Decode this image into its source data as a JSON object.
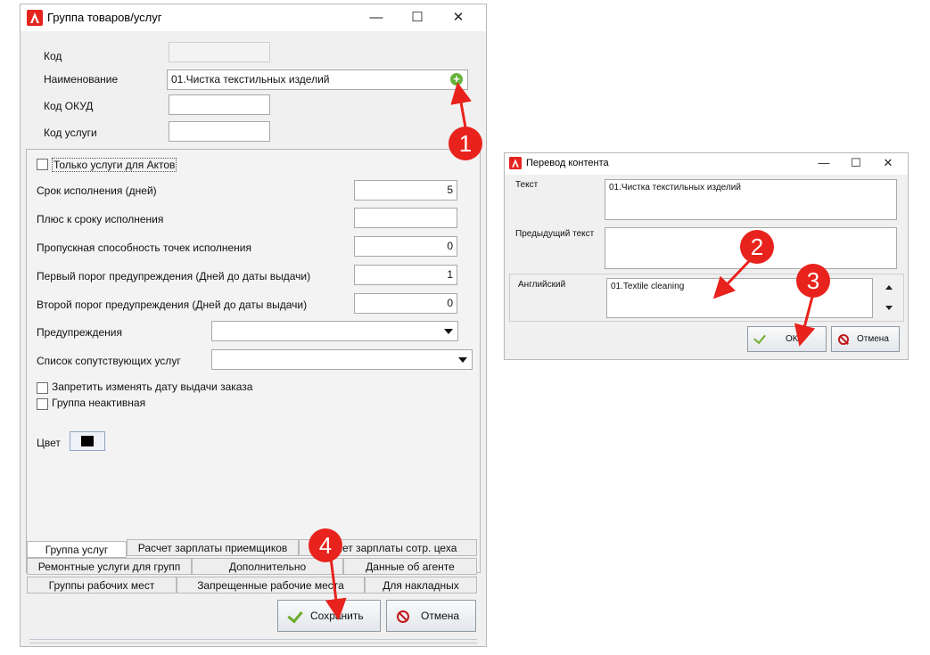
{
  "main_window": {
    "title": "Группа товаров/услуг",
    "labels": {
      "code": "Код",
      "name": "Наименование",
      "okud": "Код ОКУД",
      "service_code": "Код услуги"
    },
    "values": {
      "code": "",
      "name": "01.Чистка текстильных изделий",
      "okud": "",
      "service_code": ""
    },
    "only_acts_label": "Только услуги для Актов",
    "fields": [
      {
        "label": "Срок исполнения (дней)",
        "value": "5"
      },
      {
        "label": "Плюс к сроку исполнения",
        "value": ""
      },
      {
        "label": "Пропускная способность точек исполнения",
        "value": "0"
      },
      {
        "label": "Первый порог предупреждения (Дней до даты выдачи)",
        "value": "1"
      },
      {
        "label": "Второй порог предупреждения (Дней до даты выдачи)",
        "value": "0"
      }
    ],
    "warnings_label": "Предупреждения",
    "related_label": "Список сопутствующих услуг",
    "forbid_date_label": "Запретить изменять дату выдачи заказа",
    "inactive_label": "Группа неактивная",
    "color_label": "Цвет",
    "color_value": "#000000",
    "tabs_row1": [
      "Группа услуг",
      "Расчет зарплаты приемщиков",
      "Расчет зарплаты сотр. цеха"
    ],
    "tabs_row2": [
      "Ремонтные услуги для групп",
      "Дополнительно",
      "Данные об агенте"
    ],
    "tabs_row3": [
      "Группы рабочих мест",
      "Запрещенные рабочие места",
      "Для накладных"
    ],
    "save_label": "Сохранить",
    "cancel_label": "Отмена"
  },
  "dialog": {
    "title": "Перевод контента",
    "text_label": "Текст",
    "text_value": "01.Чистка текстильных изделий",
    "prev_label": "Предыдущий текст",
    "prev_value": "",
    "english_label": "Английский",
    "english_value": "01.Textile cleaning",
    "ok_label": "OK",
    "cancel_label": "Отмена"
  },
  "markers": [
    "1",
    "2",
    "3",
    "4"
  ],
  "colors": {
    "accent_red": "#e8221c",
    "check_green": "#6cad2c",
    "cancel_red": "#c0191b"
  }
}
